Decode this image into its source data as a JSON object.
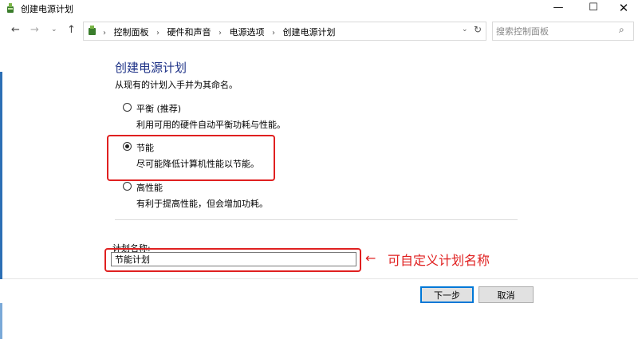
{
  "window": {
    "title": "创建电源计划",
    "controls": {
      "minimize": "—",
      "maximize": "☐",
      "close": "✕"
    }
  },
  "nav": {
    "back": "←",
    "forward": "→",
    "recent": "⌄",
    "up": "↑",
    "breadcrumbs": [
      "控制面板",
      "硬件和声音",
      "电源选项",
      "创建电源计划"
    ],
    "breadcrumb_sep": "›",
    "dropdown": "⌄",
    "refresh": "↻",
    "search_placeholder": "搜索控制面板",
    "search_icon": "⌕"
  },
  "content": {
    "title": "创建电源计划",
    "subtitle": "从现有的计划入手并为其命名。",
    "options": [
      {
        "label": "平衡 (推荐)",
        "description": "利用可用的硬件自动平衡功耗与性能。",
        "checked": false
      },
      {
        "label": "节能",
        "description": "尽可能降低计算机性能以节能。",
        "checked": true
      },
      {
        "label": "高性能",
        "description": "有利于提高性能，但会增加功耗。",
        "checked": false
      }
    ],
    "plan_name_label": "计划名称:",
    "plan_name_value": "节能计划"
  },
  "annotation": {
    "arrow": "←",
    "text": "可自定义计划名称",
    "color": "#e02020"
  },
  "buttons": {
    "next": "下一步",
    "cancel": "取消"
  },
  "colors": {
    "title_blue": "#1e3287",
    "accent": "#0078d7"
  }
}
